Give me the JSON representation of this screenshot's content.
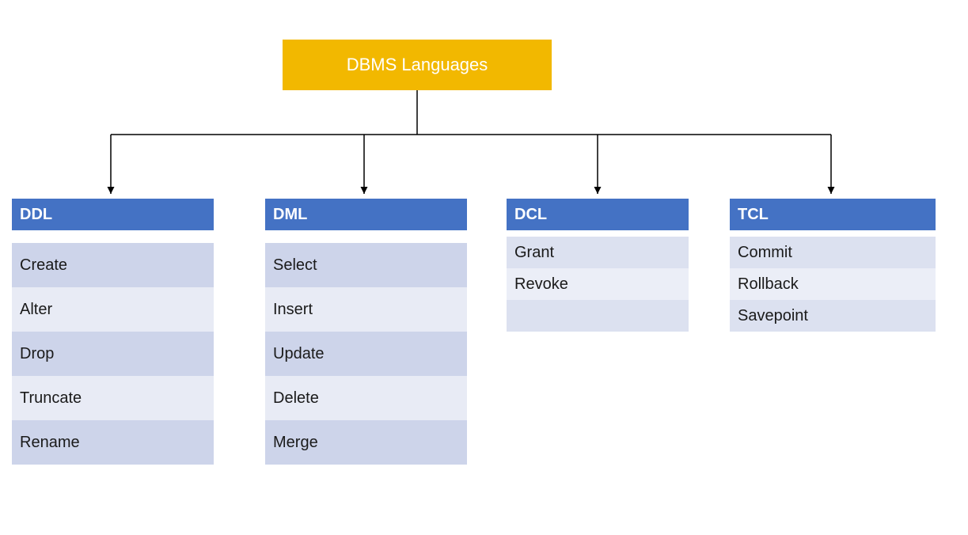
{
  "root": {
    "title": "DBMS Languages"
  },
  "categories": [
    {
      "key": "ddl",
      "label": "DDL",
      "items": [
        "Create",
        "Alter",
        "Drop",
        "Truncate",
        "Rename"
      ]
    },
    {
      "key": "dml",
      "label": "DML",
      "items": [
        "Select",
        "Insert",
        "Update",
        "Delete",
        "Merge"
      ]
    },
    {
      "key": "dcl",
      "label": "DCL",
      "items": [
        "Grant",
        "Revoke",
        ""
      ]
    },
    {
      "key": "tcl",
      "label": "TCL",
      "items": [
        "Commit",
        "Rollback",
        "Savepoint"
      ]
    }
  ],
  "colors": {
    "root_bg": "#F2B800",
    "header_bg": "#4472C4",
    "row_a": "#CDD4EA",
    "row_b": "#E8EBF5"
  }
}
